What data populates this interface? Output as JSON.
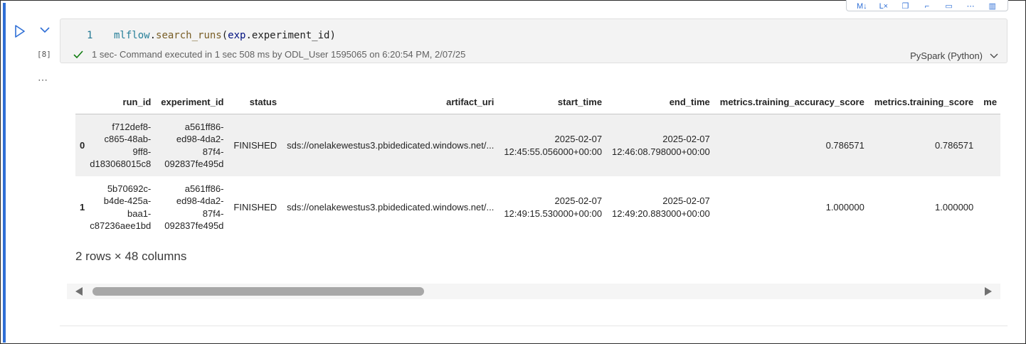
{
  "cell": {
    "execution_count": "[8]",
    "line_number": "1",
    "code": {
      "obj": "mlflow",
      "dot1": ".",
      "fn": "search_runs",
      "open": "(",
      "arg": "exp",
      "rest": ".experiment_id)"
    },
    "status_duration": "1 sec",
    "status_text": " - Command executed in 1 sec 508 ms by ODL_User 1595065 on 6:20:54 PM, 2/07/25",
    "language": "PySpark (Python)",
    "more": "⋯"
  },
  "table": {
    "columns": [
      "",
      "run_id",
      "experiment_id",
      "status",
      "artifact_uri",
      "start_time",
      "end_time",
      "metrics.training_accuracy_score",
      "metrics.training_score",
      "me"
    ],
    "rows": [
      {
        "index": "0",
        "run_id": [
          "f712def8-",
          "c865-48ab-",
          "9ff8-",
          "d183068015c8"
        ],
        "experiment_id": [
          "a561ff86-",
          "ed98-4da2-",
          "87f4-",
          "092837fe495d"
        ],
        "status": "FINISHED",
        "artifact_uri": "sds://onelakewestus3.pbidedicated.windows.net/...",
        "start_time": [
          "2025-02-07",
          "12:45:55.056000+00:00"
        ],
        "end_time": [
          "2025-02-07",
          "12:46:08.798000+00:00"
        ],
        "training_accuracy_score": "0.786571",
        "training_score": "0.786571"
      },
      {
        "index": "1",
        "run_id": [
          "5b70692c-",
          "b4de-425a-",
          "baa1-",
          "c87236aee1bd"
        ],
        "experiment_id": [
          "a561ff86-",
          "ed98-4da2-",
          "87f4-",
          "092837fe495d"
        ],
        "status": "FINISHED",
        "artifact_uri": "sds://onelakewestus3.pbidedicated.windows.net/...",
        "start_time": [
          "2025-02-07",
          "12:49:15.530000+00:00"
        ],
        "end_time": [
          "2025-02-07",
          "12:49:20.883000+00:00"
        ],
        "training_accuracy_score": "1.000000",
        "training_score": "1.000000"
      }
    ],
    "shape": "2 rows × 48 columns"
  },
  "colors": {
    "accent": "#2f6fd6",
    "success": "#107c10",
    "stripe": "#f0f0f0"
  },
  "icons": {
    "run": "play-icon",
    "collapse": "chevron-down-icon",
    "status": "check-icon",
    "language": "chevron-down-icon"
  }
}
